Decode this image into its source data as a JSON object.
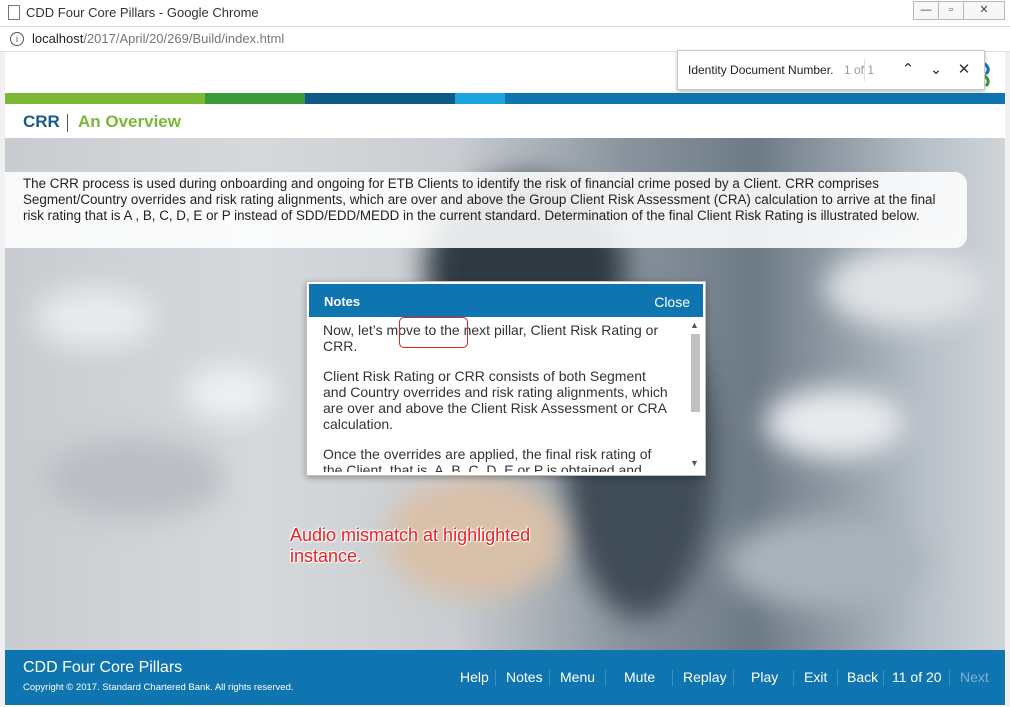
{
  "window": {
    "title": "CDD Four Core Pillars - Google Chrome",
    "url_host": "localhost",
    "url_path": "/2017/April/20/269/Build/index.html"
  },
  "find_bar": {
    "query": "Identity Document Number.",
    "count": "1 of 1"
  },
  "header": {
    "section": "CRR",
    "subtitle": "An Overview",
    "colors": [
      "#7ab836",
      "#3a9a3a",
      "#0d5a86",
      "#1aa3dc",
      "#0f75b0"
    ]
  },
  "description": "The CRR process is used during onboarding and ongoing for ETB Clients to identify the risk of financial crime posed by a Client. CRR comprises Segment/Country overrides and risk rating alignments, which are over and above the Group Client Risk Assessment (CRA) calculation to arrive at the final risk rating that is A , B, C, D, E or P instead of SDD/EDD/MEDD in the current standard. Determination of the final Client Risk Rating is illustrated below.",
  "notes": {
    "title": "Notes",
    "close_label": "Close",
    "paragraphs": [
      "Now, let’s move to the next pillar, Client Risk Rating or CRR.",
      "Client Risk Rating or CRR consists of both Segment and Country overrides and risk rating alignments, which are over and above the Client Risk Assessment or CRA calculation.",
      "Once the overrides are applied, the final risk rating of the Client, that is, A, B, C, D, E or P is obtained and"
    ]
  },
  "annotation": "Audio mismatch at highlighted instance.",
  "footer": {
    "title": "CDD Four Core Pillars",
    "copyright": "Copyright © 2017. Standard Chartered Bank. All rights reserved.",
    "nav": {
      "help": "Help",
      "notes": "Notes",
      "menu": "Menu",
      "mute": "Mute",
      "replay": "Replay",
      "play": "Play",
      "exit": "Exit",
      "back": "Back",
      "page": "11 of 20",
      "next": "Next"
    }
  }
}
